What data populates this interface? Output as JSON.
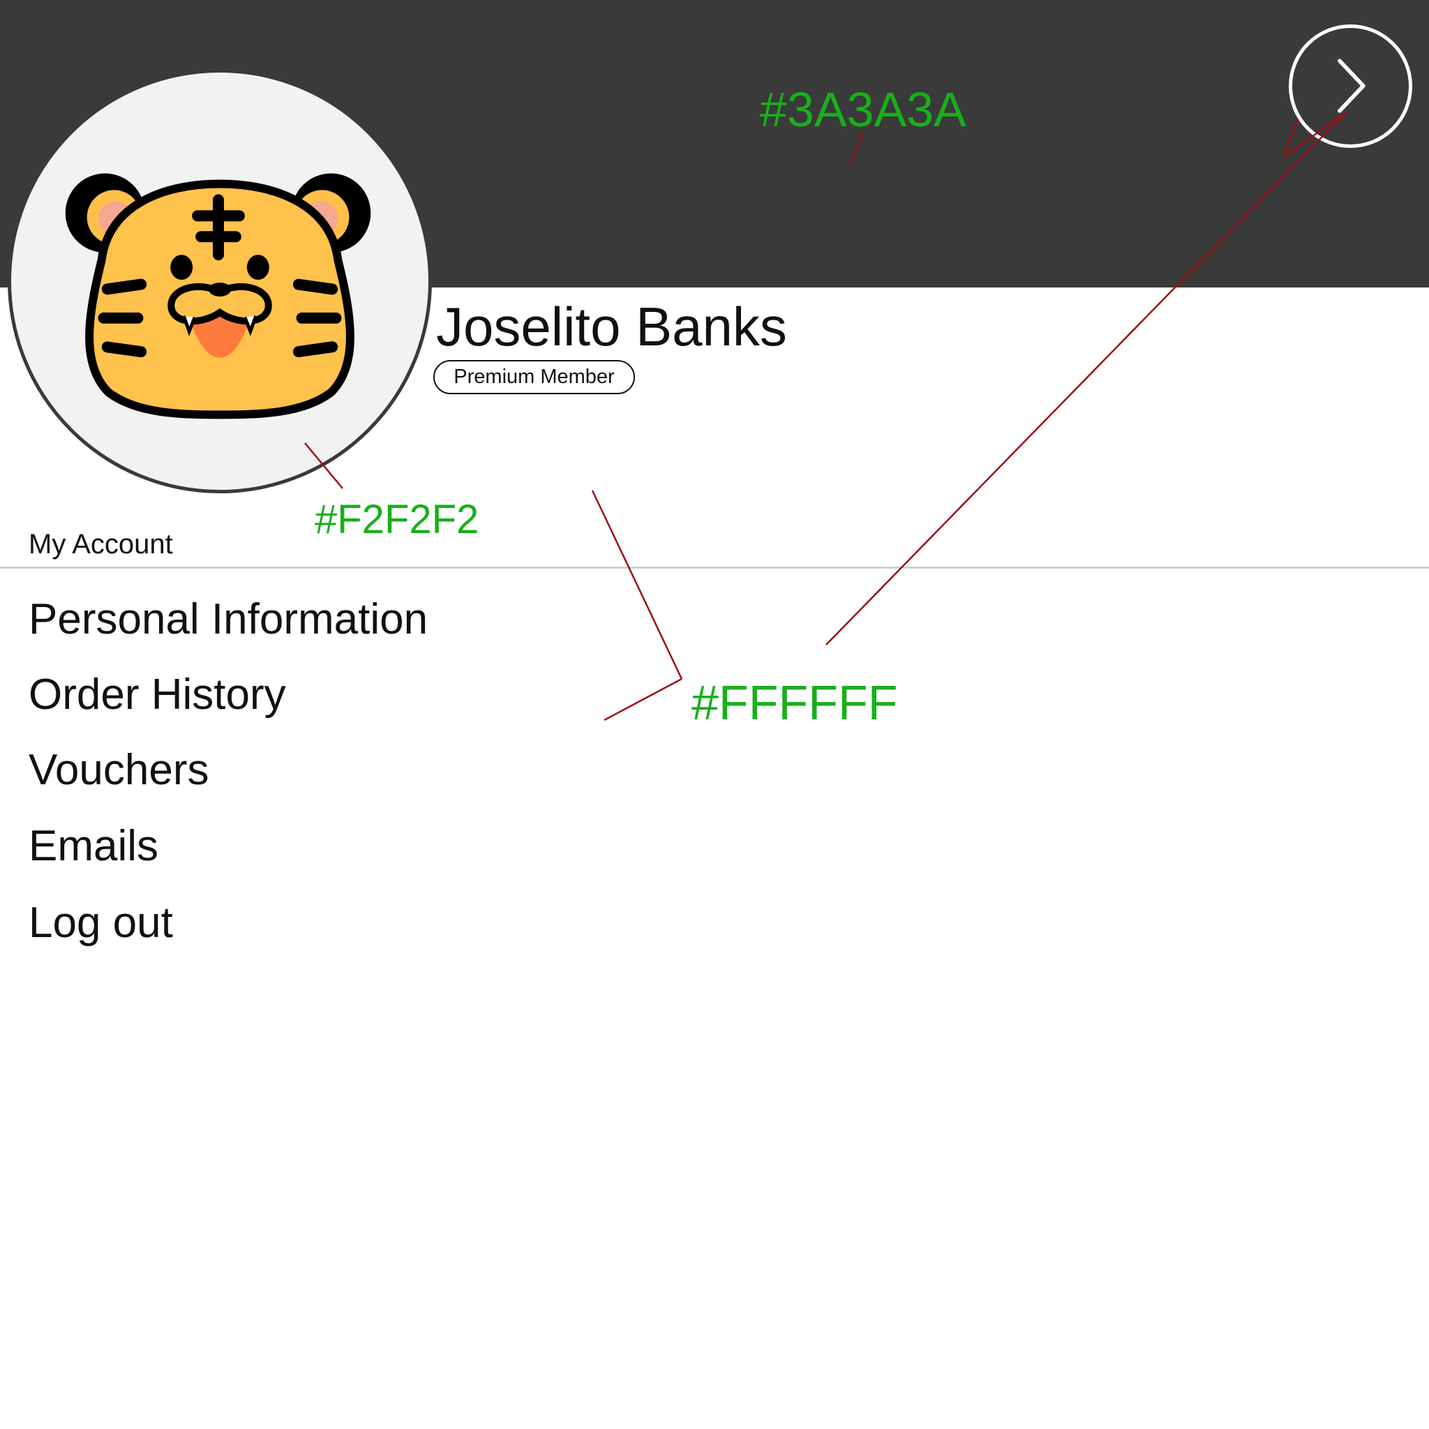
{
  "profile": {
    "name": "Joselito Banks",
    "badge": "Premium Member",
    "avatar_icon": "tiger-face-icon"
  },
  "header": {
    "next_icon": "chevron-right-icon"
  },
  "menu": {
    "section_label": "My Account",
    "items": [
      {
        "label": "Personal Information"
      },
      {
        "label": "Order History"
      },
      {
        "label": "Vouchers"
      },
      {
        "label": "Emails"
      },
      {
        "label": "Log out"
      }
    ]
  },
  "annotations": {
    "header_color": "#3A3A3A",
    "avatar_color": "#F2F2F2",
    "background_color": "#FFFFFF"
  },
  "colors": {
    "header_bg": "#3A3A3A",
    "avatar_bg": "#F2F2F2",
    "page_bg": "#FFFFFF",
    "annotation_text": "#17B01A",
    "annotation_line": "#9B0F14"
  }
}
